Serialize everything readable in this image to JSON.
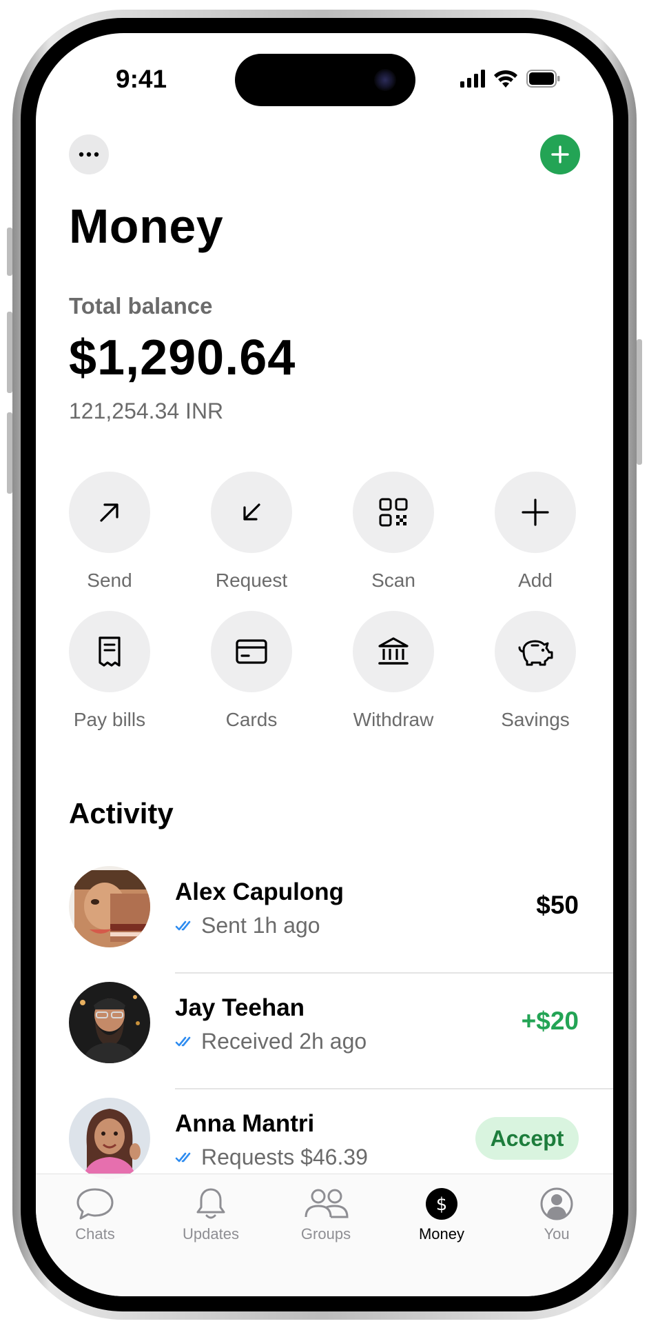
{
  "status": {
    "time": "9:41"
  },
  "header": {
    "title": "Money"
  },
  "balance": {
    "label": "Total balance",
    "amount": "$1,290.64",
    "secondary": "121,254.34 INR"
  },
  "actions": [
    {
      "label": "Send",
      "icon": "arrow-up-right-icon"
    },
    {
      "label": "Request",
      "icon": "arrow-down-left-icon"
    },
    {
      "label": "Scan",
      "icon": "qr-code-icon"
    },
    {
      "label": "Add",
      "icon": "plus-icon"
    },
    {
      "label": "Pay bills",
      "icon": "receipt-icon"
    },
    {
      "label": "Cards",
      "icon": "card-icon"
    },
    {
      "label": "Withdraw",
      "icon": "bank-icon"
    },
    {
      "label": "Savings",
      "icon": "piggy-bank-icon"
    }
  ],
  "activity": {
    "title": "Activity",
    "items": [
      {
        "name": "Alex Capulong",
        "sub": "Sent 1h ago",
        "amount": "$50"
      },
      {
        "name": "Jay Teehan",
        "sub": "Received 2h ago",
        "amount": "+$20"
      },
      {
        "name": "Anna Mantri",
        "sub": "Requests $46.39",
        "action": "Accept"
      }
    ]
  },
  "tabbar": {
    "tabs": [
      {
        "label": "Chats",
        "icon": "chat-bubble-icon"
      },
      {
        "label": "Updates",
        "icon": "bell-icon"
      },
      {
        "label": "Groups",
        "icon": "people-icon"
      },
      {
        "label": "Money",
        "icon": "dollar-icon",
        "active": true
      },
      {
        "label": "You",
        "icon": "profile-icon"
      }
    ]
  },
  "colors": {
    "accent_green": "#23a455",
    "positive_amount": "#23a455",
    "accept_bg": "#d9f4df",
    "check_blue": "#2e8cf0"
  }
}
